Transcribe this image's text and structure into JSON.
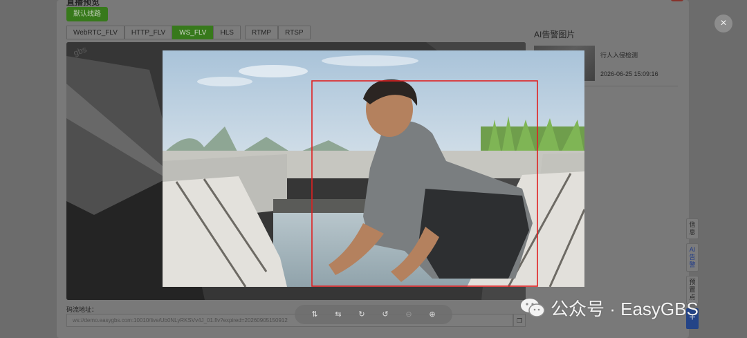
{
  "dialog": {
    "title": "直播预览",
    "route_button": "默认线路",
    "protocol_tabs": [
      {
        "label": "WebRTC_FLV",
        "active": false
      },
      {
        "label": "HTTP_FLV",
        "active": false
      },
      {
        "label": "WS_FLV",
        "active": true
      },
      {
        "label": "HLS",
        "active": false
      },
      {
        "label": "RTMP",
        "active": false
      },
      {
        "label": "RTSP",
        "active": false
      }
    ],
    "stream_label": "码流地址：",
    "stream_url": "ws://demo.easygbs.com:10010/live/Ub0NLyRKSVv4J_01.flv?expired=20260905150912",
    "video_watermark": "gbs"
  },
  "ai_panel": {
    "title": "AI告警图片",
    "items": [
      {
        "title": "行人入侵检测",
        "time": "2026-06-25 15:09:16"
      }
    ]
  },
  "side_tabs": [
    {
      "label": "信息",
      "active": false
    },
    {
      "label": "AI告警",
      "active": true
    },
    {
      "label": "预置点",
      "active": false
    }
  ],
  "side_plus": "+",
  "viewer": {
    "close_symbol": "×",
    "tools": [
      {
        "icon": "flip-vertical-icon",
        "glyph": "⇅",
        "disabled": false
      },
      {
        "icon": "flip-horizontal-icon",
        "glyph": "⇆",
        "disabled": false
      },
      {
        "icon": "rotate-right-icon",
        "glyph": "↻",
        "disabled": false
      },
      {
        "icon": "rotate-left-icon",
        "glyph": "↺",
        "disabled": false
      },
      {
        "icon": "zoom-out-icon",
        "glyph": "⊖",
        "disabled": true
      },
      {
        "icon": "zoom-in-icon",
        "glyph": "⊕",
        "disabled": false
      }
    ],
    "detection_box_color": "#e02020"
  },
  "watermark": {
    "text": "公众号 · EasyGBS"
  }
}
